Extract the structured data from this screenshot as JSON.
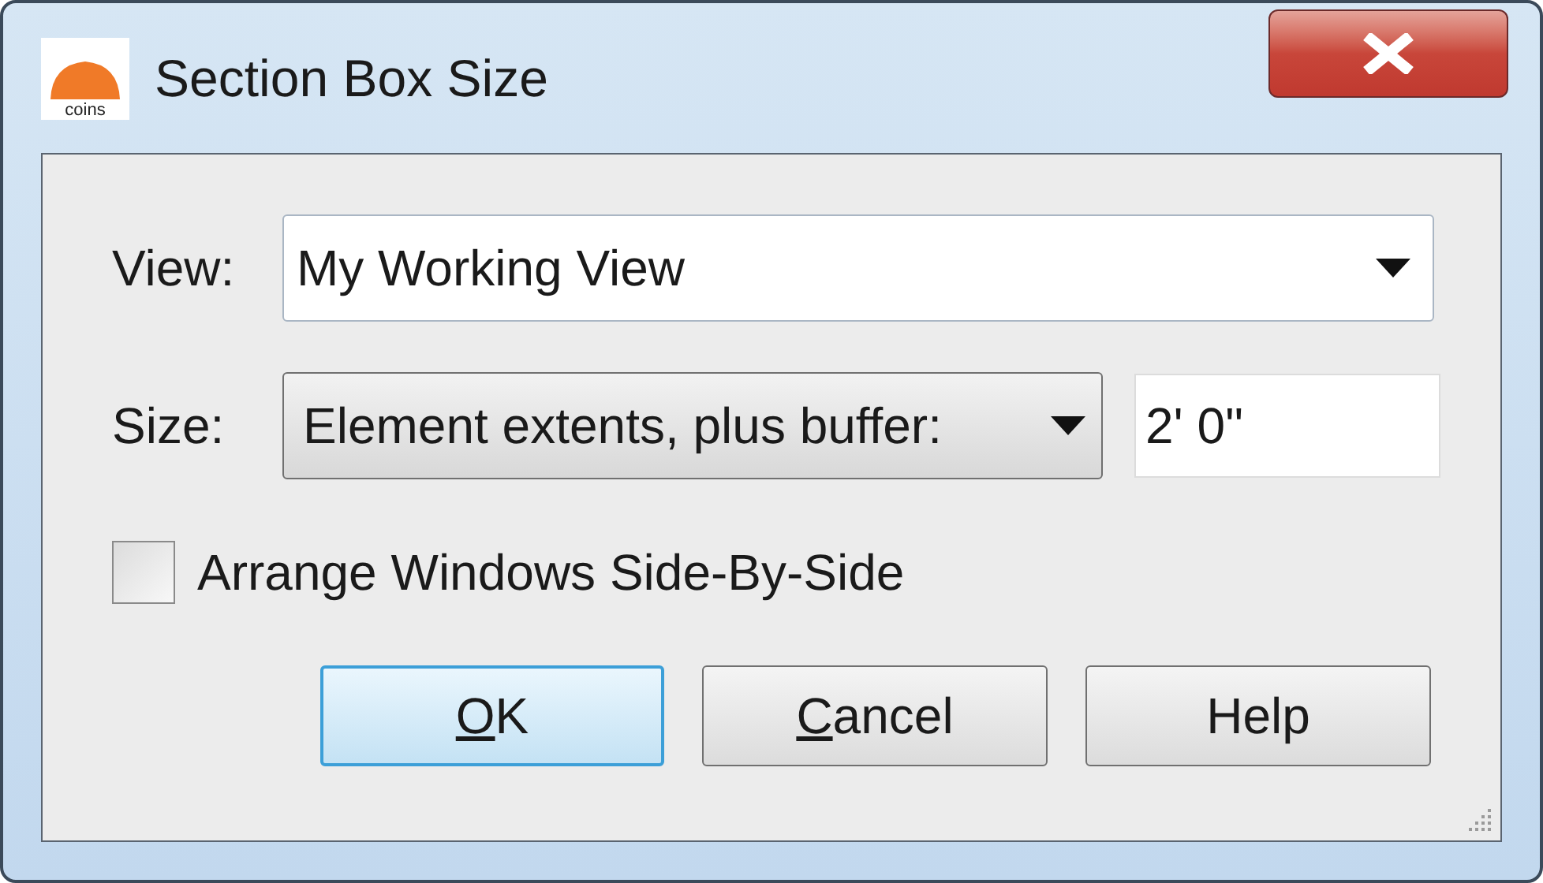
{
  "window": {
    "title": "Section Box Size",
    "logo_text": "coins"
  },
  "view": {
    "label": "View:",
    "value": "My Working View"
  },
  "size": {
    "label": "Size:",
    "value": "Element extents, plus buffer:",
    "buffer": "2' 0\""
  },
  "options": [
    {
      "label": "Arrange Windows Side-By-Side",
      "checked": false
    }
  ],
  "buttons": [
    {
      "label": "OK",
      "underline_first": true,
      "default": true
    },
    {
      "label": "Cancel",
      "underline_first": true,
      "default": false
    },
    {
      "label": "Help",
      "underline_first": false,
      "default": false
    }
  ]
}
